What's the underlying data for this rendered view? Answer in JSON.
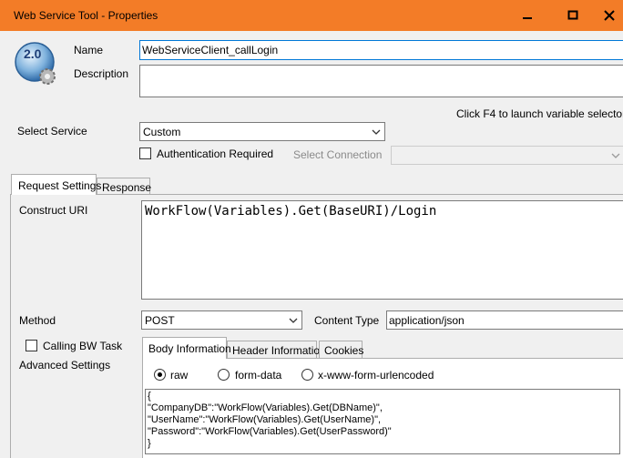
{
  "window": {
    "title": "Web Service Tool - Properties",
    "titlebar_color": "#f37c27",
    "buttons": [
      "minimize-icon",
      "maximize-icon",
      "close-icon"
    ]
  },
  "logo": {
    "version": "2.0"
  },
  "name": {
    "label": "Name",
    "value": "WebServiceClient_callLogin"
  },
  "description": {
    "label": "Description",
    "value": ""
  },
  "hint": "Click F4 to launch variable selector",
  "select_service": {
    "label": "Select Service",
    "value": "Custom"
  },
  "auth_required": {
    "label": "Authentication Required",
    "checked": false
  },
  "select_connection": {
    "label": "Select Connection",
    "value": ""
  },
  "tabs": {
    "request": "Request Settings",
    "response": "Response"
  },
  "construct_uri": {
    "label": "Construct URI",
    "value": "WorkFlow(Variables).Get(BaseURI)/Login"
  },
  "method": {
    "label": "Method",
    "value": "POST"
  },
  "content_type": {
    "label": "Content Type",
    "value": "application/json"
  },
  "calling_bw_task": {
    "label": "Calling BW Task",
    "checked": false
  },
  "advanced_settings": {
    "label": "Advanced Settings"
  },
  "body_tabs": {
    "body": "Body Information",
    "header": "Header Information",
    "cookies": "Cookies"
  },
  "body_type": {
    "raw": "raw",
    "form_data": "form-data",
    "urlencoded": "x-www-form-urlencoded",
    "selected": "raw"
  },
  "body_content": {
    "line1": "{",
    "line2": "\"CompanyDB\":\"WorkFlow(Variables).Get(DBName)\",",
    "line3": "\"UserName\":\"WorkFlow(Variables).Get(UserName)\",",
    "line4": "\"Password\":\"WorkFlow(Variables).Get(UserPassword)\"",
    "line5": "}"
  }
}
